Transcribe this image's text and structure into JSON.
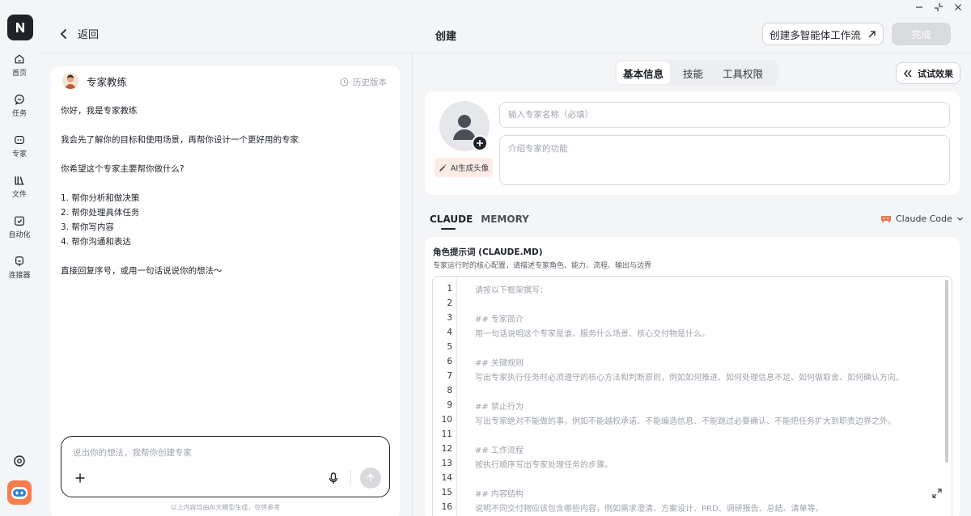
{
  "window": {
    "minimize": "–",
    "restore": "⤡",
    "close": "✕"
  },
  "sidebar": {
    "items": [
      {
        "label": "首页",
        "icon": "home-icon"
      },
      {
        "label": "任务",
        "icon": "task-icon"
      },
      {
        "label": "专家",
        "icon": "expert-icon"
      },
      {
        "label": "文件",
        "icon": "files-icon"
      },
      {
        "label": "自动化",
        "icon": "automation-icon"
      },
      {
        "label": "连接器",
        "icon": "connector-icon"
      }
    ]
  },
  "header": {
    "back_label": "返回",
    "title": "创建",
    "multi_agent_label": "创建多智能体工作流",
    "done_label": "完成"
  },
  "chat": {
    "agent_name": "专家教练",
    "history_label": "历史版本",
    "messages": [
      "你好，我是专家教练",
      "我会先了解你的目标和使用场景，再帮你设计一个更好用的专家",
      "你希望这个专家主要帮你做什么?",
      "1. 帮你分析和做决策",
      "2. 帮你处理具体任务",
      "3. 帮你写内容",
      "4. 帮你沟通和表达",
      "直接回复序号，或用一句话说说你的想法～"
    ],
    "input_placeholder": "说出你的想法，我帮你创建专家",
    "disclaimer": "以上内容均由AI大模型生成，仅供参考"
  },
  "config": {
    "tabs": [
      "基本信息",
      "技能",
      "工具权限"
    ],
    "active_tab": "基本信息",
    "try_label": "试试效果",
    "ai_avatar_label": "AI生成头像",
    "name_placeholder": "输入专家名称（必填）",
    "desc_placeholder": "介绍专家的功能",
    "mode_tabs": [
      "CLAUDE",
      "MEMORY"
    ],
    "engine": "Claude Code",
    "prompt_title": "角色提示词 (CLAUDE.MD)",
    "prompt_subtitle": "专家运行时的核心配置，请描述专家角色、能力、流程、输出与边界",
    "editor_lines": [
      {
        "n": "1",
        "text": "请按以下框架撰写："
      },
      {
        "n": "2",
        "text": ""
      },
      {
        "n": "3",
        "text": "## 专家简介"
      },
      {
        "n": "4",
        "text": "用一句话说明这个专家是谁、服务什么场景、核心交付物是什么。"
      },
      {
        "n": "5",
        "text": ""
      },
      {
        "n": "6",
        "text": "## 关键规则"
      },
      {
        "n": "7",
        "text": "写出专家执行任务时必须遵守的核心方法和判断原则，例如如何推进、如何处理信息不足、如何做取舍、如何确认方向。"
      },
      {
        "n": "8",
        "text": ""
      },
      {
        "n": "9",
        "text": "## 禁止行为"
      },
      {
        "n": "10",
        "text": "写出专家绝对不能做的事，例如不能越权承诺、不能编造信息、不能跳过必要确认、不能把任务扩大到职责边界之外。"
      },
      {
        "n": "11",
        "text": ""
      },
      {
        "n": "12",
        "text": "## 工作流程"
      },
      {
        "n": "13",
        "text": "按执行顺序写出专家处理任务的步骤。"
      },
      {
        "n": "14",
        "text": ""
      },
      {
        "n": "15",
        "text": "## 内容结构"
      },
      {
        "n": "16",
        "text": "说明不同交付物应该包含哪些内容，例如需求澄清、方案设计、PRD、调研报告、总结、清单等。"
      }
    ]
  },
  "colors": {
    "accent": "#f97d4a",
    "dark": "#1f2329",
    "disabled": "#d8dade"
  }
}
